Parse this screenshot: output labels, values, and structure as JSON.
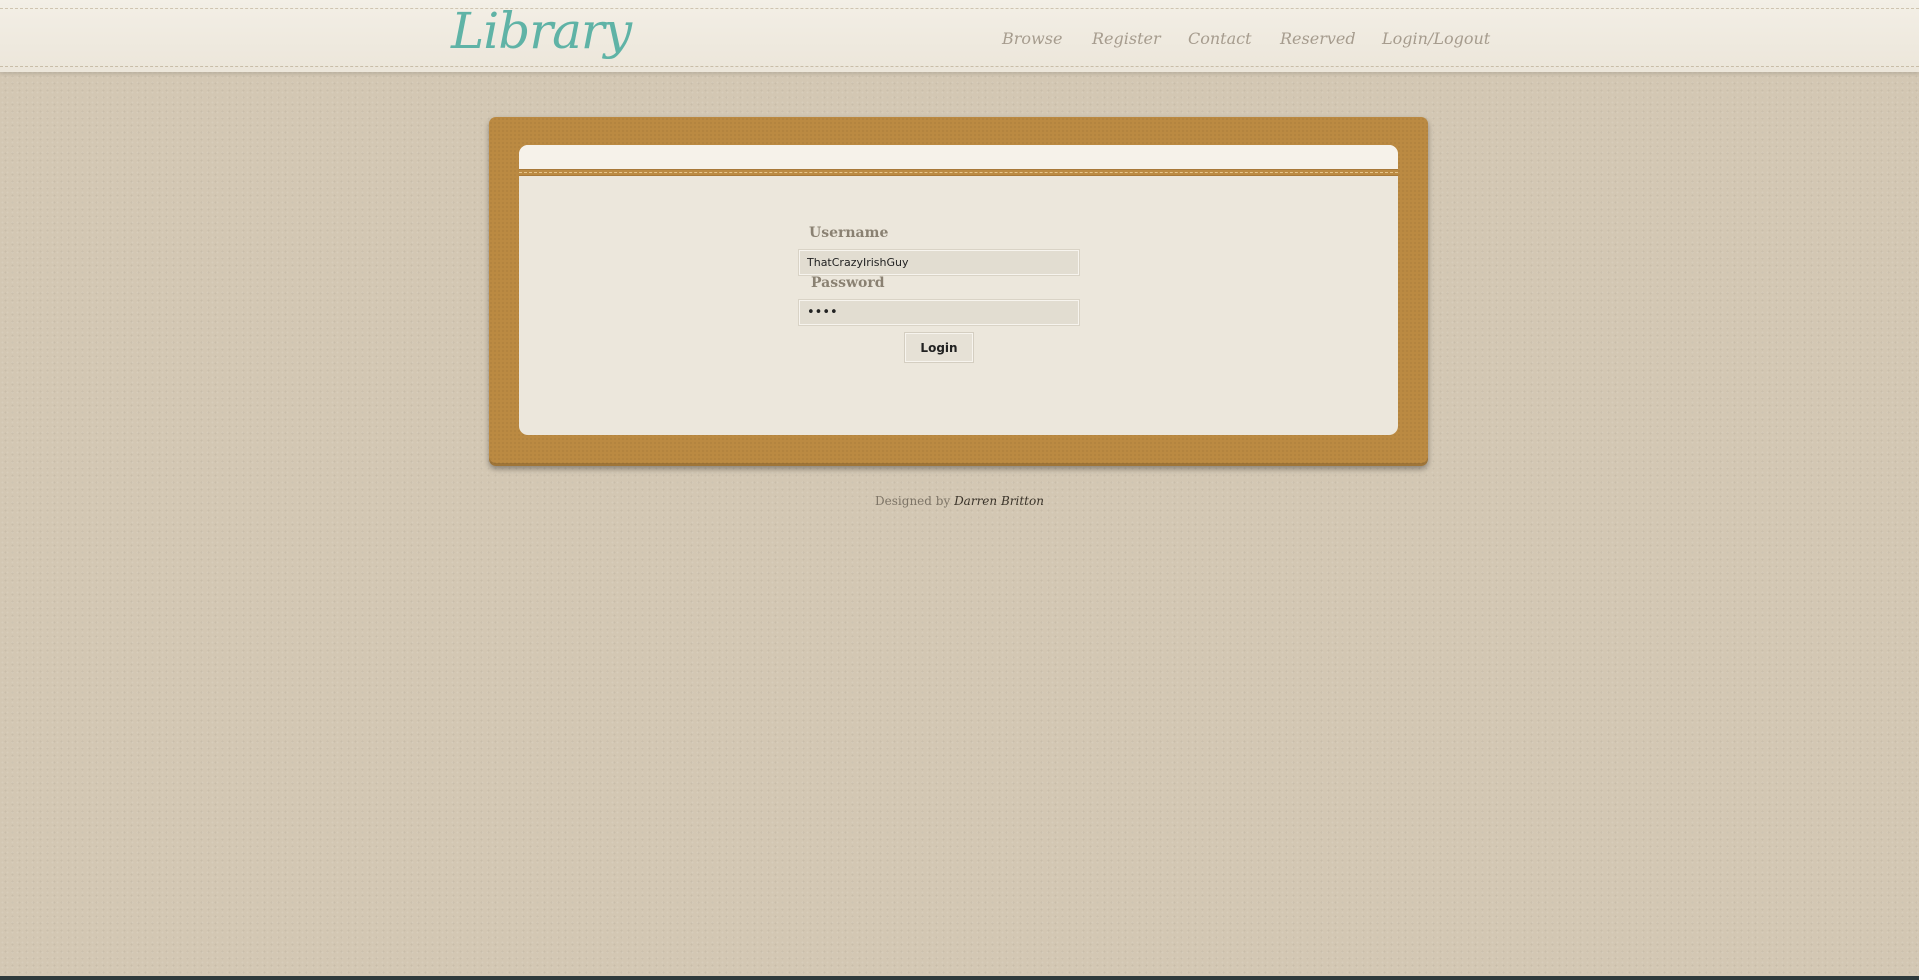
{
  "header": {
    "logo": "Library",
    "nav": [
      {
        "label": "Browse"
      },
      {
        "label": "Register"
      },
      {
        "label": "Contact"
      },
      {
        "label": "Reserved"
      },
      {
        "label": "Login/Logout"
      }
    ]
  },
  "login_form": {
    "username_label": "Username",
    "username_value": "ThatCrazyIrishGuy",
    "password_label": "Password",
    "password_value": "••••",
    "submit_label": "Login"
  },
  "footer": {
    "prefix": "Designed by",
    "author": "Darren Britton"
  },
  "colors": {
    "logo": "#5fb3a6",
    "board": "#bb8a42",
    "background": "#d3c7b3",
    "panel": "#ece7dc"
  }
}
